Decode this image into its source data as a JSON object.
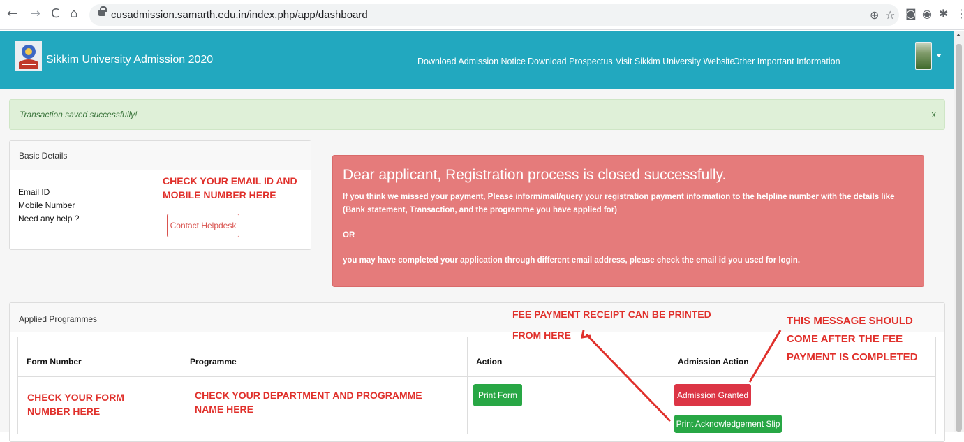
{
  "browser": {
    "back_icon": "←",
    "forward_icon": "→",
    "reload_icon": "C",
    "home_icon": "⌂",
    "url": "cusadmission.samarth.edu.in/index.php/app/dashboard",
    "zoom_icon": "⊕",
    "star_icon": "☆",
    "camera_icon": "◙",
    "ext_icon": "◉",
    "puzzle_icon": "✱",
    "menu_icon": "⋮"
  },
  "header": {
    "brand": "Sikkim University Admission 2020",
    "nav": [
      "Download Admission Notice",
      "Download Prospectus",
      "Visit Sikkim University Website",
      "Other Important Information"
    ],
    "accent_color": "#22a8bf"
  },
  "success_alert": {
    "message": "Transaction saved successfully!",
    "close": "x"
  },
  "basic_details": {
    "title": "Basic Details",
    "fields": [
      "Email ID",
      "Mobile Number",
      "Need any help ?"
    ],
    "helpdesk_button": "Contact Helpdesk",
    "annotation": [
      "CHECK YOUR EMAIL ID AND",
      "MOBILE NUMBER HERE"
    ]
  },
  "danger_alert": {
    "title": "Dear applicant, Registration process is closed successfully.",
    "body1": "If you think we missed your payment, Please inform/mail/query your registration payment information to the helpline number with the details like (Bank statement, Transaction, and the programme you have applied for)",
    "or": "OR",
    "body2": "you may have completed your application through different email address, please check the email id you used for login."
  },
  "applied_programmes": {
    "title": "Applied Programmes",
    "columns": [
      "Form Number",
      "Programme",
      "Action",
      "Admission Action"
    ],
    "row": {
      "form_annotation": [
        "CHECK YOUR FORM",
        "NUMBER HERE"
      ],
      "programme_annotation": [
        "CHECK YOUR DEPARTMENT AND PROGRAMME",
        "NAME HERE"
      ],
      "print_form_button": "Print Form",
      "admission_granted_button": "Admission Granted",
      "print_ack_button": "Print Acknowledgement Slip"
    }
  },
  "annotations": {
    "fee_receipt": [
      "FEE PAYMENT RECEIPT CAN BE PRINTED",
      "FROM HERE"
    ],
    "after_fee": [
      "THIS MESSAGE SHOULD",
      "COME AFTER THE FEE",
      "PAYMENT IS COMPLETED"
    ]
  }
}
